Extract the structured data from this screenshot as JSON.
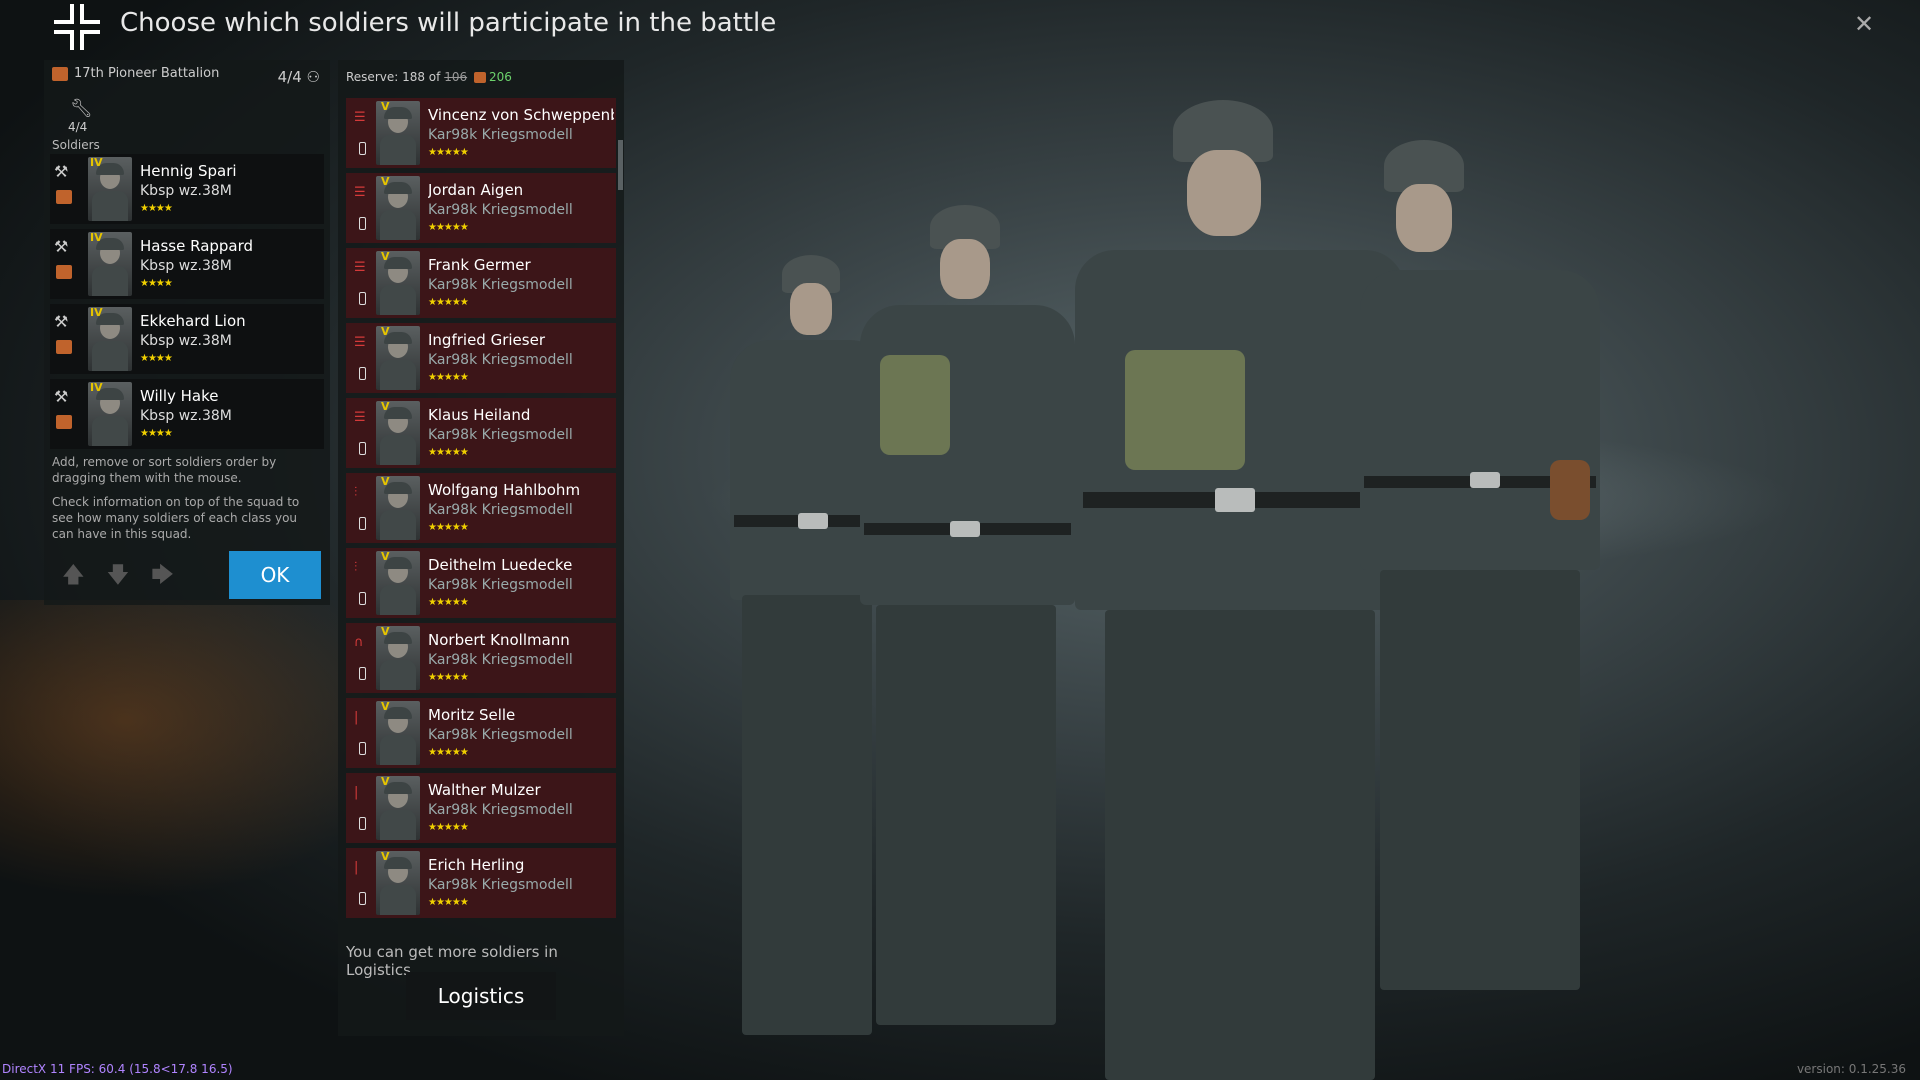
{
  "header": {
    "title": "Choose which soldiers will participate in the battle",
    "close": "✕"
  },
  "squad": {
    "name": "17th Pioneer Battalion",
    "count": "4/4",
    "tool_count": "4/4",
    "soldiers_label": "Soldiers",
    "soldiers": [
      {
        "rank": "IV",
        "name": "Hennig Spari",
        "weapon": "Kbsp wz.38M",
        "stars": "★★★★"
      },
      {
        "rank": "IV",
        "name": "Hasse Rappard",
        "weapon": "Kbsp wz.38M",
        "stars": "★★★★"
      },
      {
        "rank": "IV",
        "name": "Ekkehard Lion",
        "weapon": "Kbsp wz.38M",
        "stars": "★★★★"
      },
      {
        "rank": "IV",
        "name": "Willy Hake",
        "weapon": "Kbsp wz.38M",
        "stars": "★★★★"
      }
    ],
    "help1": "Add, remove or sort soldiers order by dragging them with the mouse.",
    "help2": "Check information on top of the squad to see how many soldiers of each class you can have in this squad.",
    "ok_label": "OK"
  },
  "reserve": {
    "label": "Reserve: 188 of",
    "old_max": "106",
    "new_max": "206",
    "soldiers": [
      {
        "rank": "V",
        "name": "Vincenz von Schweppenburg",
        "weapon": "Kar98k Kriegsmodell",
        "stars": "★★★★★",
        "cls": "☰"
      },
      {
        "rank": "V",
        "name": "Jordan Aigen",
        "weapon": "Kar98k Kriegsmodell",
        "stars": "★★★★★",
        "cls": "☰"
      },
      {
        "rank": "V",
        "name": "Frank Germer",
        "weapon": "Kar98k Kriegsmodell",
        "stars": "★★★★★",
        "cls": "☰"
      },
      {
        "rank": "V",
        "name": "Ingfried Grieser",
        "weapon": "Kar98k Kriegsmodell",
        "stars": "★★★★★",
        "cls": "☰"
      },
      {
        "rank": "V",
        "name": "Klaus Heiland",
        "weapon": "Kar98k Kriegsmodell",
        "stars": "★★★★★",
        "cls": "☰"
      },
      {
        "rank": "V",
        "name": "Wolfgang Hahlbohm",
        "weapon": "Kar98k Kriegsmodell",
        "stars": "★★★★★",
        "cls": "⫶"
      },
      {
        "rank": "V",
        "name": "Deithelm Luedecke",
        "weapon": "Kar98k Kriegsmodell",
        "stars": "★★★★★",
        "cls": "⫶"
      },
      {
        "rank": "V",
        "name": "Norbert Knollmann",
        "weapon": "Kar98k Kriegsmodell",
        "stars": "★★★★★",
        "cls": "∩"
      },
      {
        "rank": "V",
        "name": "Moritz Selle",
        "weapon": "Kar98k Kriegsmodell",
        "stars": "★★★★★",
        "cls": "|"
      },
      {
        "rank": "V",
        "name": "Walther Mulzer",
        "weapon": "Kar98k Kriegsmodell",
        "stars": "★★★★★",
        "cls": "|"
      },
      {
        "rank": "V",
        "name": "Erich Herling",
        "weapon": "Kar98k Kriegsmodell",
        "stars": "★★★★★",
        "cls": "|"
      }
    ],
    "more_text": "You can get more soldiers in Logistics",
    "logistics_label": "Logistics"
  },
  "footer": {
    "fps": "DirectX 11 FPS: 60.4 (15.8<17.8 16.5)",
    "version": "version: 0.1.25.36"
  },
  "colors": {
    "ok_button": "#1e8fd0",
    "reserve_row": "#3c1518",
    "rank": "#e6c400",
    "stars": "#f0d000"
  }
}
